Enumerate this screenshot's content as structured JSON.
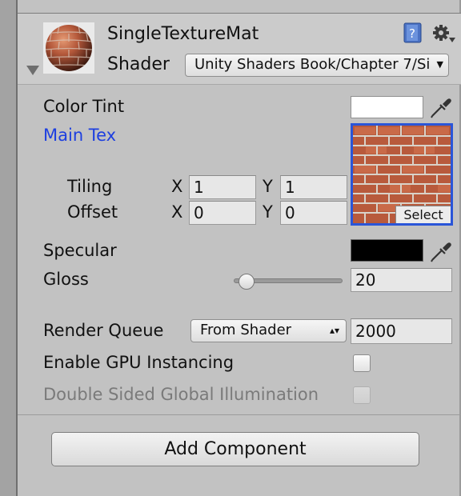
{
  "material": {
    "name": "SingleTextureMat",
    "shader_label": "Shader",
    "shader_value": "Unity Shaders Book/Chapter 7/Si"
  },
  "properties": {
    "color_tint": {
      "label": "Color Tint",
      "color": "#ffffff"
    },
    "main_tex": {
      "label": "Main Tex",
      "select_label": "Select",
      "tiling": {
        "label": "Tiling",
        "x_label": "X",
        "x": "1",
        "y_label": "Y",
        "y": "1"
      },
      "offset": {
        "label": "Offset",
        "x_label": "X",
        "x": "0",
        "y_label": "Y",
        "y": "0"
      }
    },
    "specular": {
      "label": "Specular",
      "color": "#000000"
    },
    "gloss": {
      "label": "Gloss",
      "value": "20",
      "slider_fraction": 0.05
    }
  },
  "render_queue": {
    "label": "Render Queue",
    "mode": "From Shader",
    "value": "2000"
  },
  "gpu_instancing": {
    "label": "Enable GPU Instancing",
    "checked": false
  },
  "double_sided_gi": {
    "label": "Double Sided Global Illumination",
    "checked": false,
    "enabled": false
  },
  "add_component": {
    "label": "Add Component"
  },
  "colors": {
    "link_blue": "#1d3fe0",
    "select_outline": "#2a55d8"
  }
}
